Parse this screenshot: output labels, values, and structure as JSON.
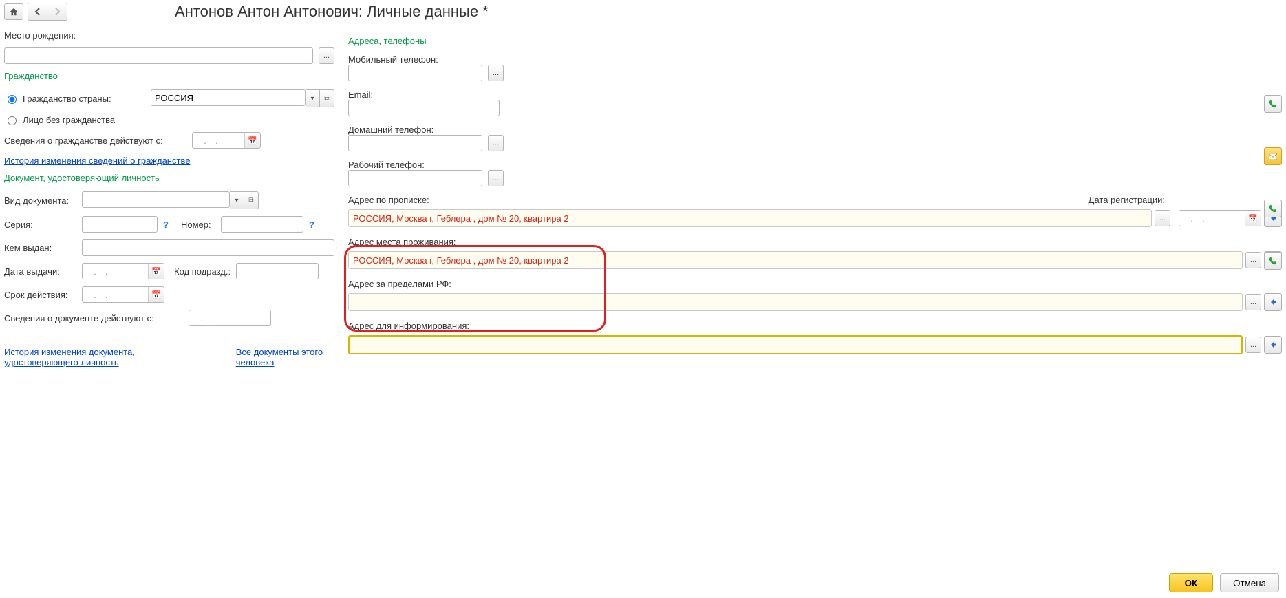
{
  "header": {
    "title": "Антонов Антон Антонович: Личные данные *"
  },
  "birth": {
    "label": "Место рождения:",
    "value": ""
  },
  "citizenship": {
    "section": "Гражданство",
    "radio_country_label": "Гражданство страны:",
    "country_value": "РОССИЯ",
    "radio_stateless_label": "Лицо без гражданства",
    "valid_from_label": "Сведения о гражданстве действуют с:",
    "valid_from_value": "  .  .",
    "history_link": "История изменения сведений о гражданстве"
  },
  "identity": {
    "section": "Документ, удостоверяющий личность",
    "doc_type_label": "Вид документа:",
    "doc_type_value": "",
    "series_label": "Серия:",
    "series_value": "",
    "number_label": "Номер:",
    "number_value": "",
    "issued_by_label": "Кем выдан:",
    "issued_by_value": "",
    "issue_date_label": "Дата выдачи:",
    "issue_date_value": "  .  .",
    "dept_code_label": "Код подразд.:",
    "dept_code_value": "",
    "validity_label": "Срок действия:",
    "validity_value": "  .  .",
    "info_valid_from_label": "Сведения о документе действуют с:",
    "info_valid_from_value": "  .  .",
    "history_link": "История изменения документа, удостоверяющего личность",
    "all_docs_link": "Все документы этого человека"
  },
  "contacts": {
    "section": "Адреса, телефоны",
    "mobile_label": "Мобильный телефон:",
    "mobile_value": "",
    "email_label": "Email:",
    "email_value": "",
    "home_phone_label": "Домашний телефон:",
    "home_phone_value": "",
    "work_phone_label": "Рабочий телефон:",
    "work_phone_value": "",
    "reg_addr_label": "Адрес по прописке:",
    "reg_addr_value": "РОССИЯ, Москва г, Геблера , дом № 20, квартира 2",
    "reg_date_label": "Дата регистрации:",
    "reg_date_value": "  .  .",
    "live_addr_label": "Адрес места проживания:",
    "live_addr_value": "РОССИЯ, Москва г, Геблера , дом № 20, квартира 2",
    "abroad_addr_label": "Адрес за пределами РФ:",
    "abroad_addr_value": "",
    "notify_addr_label": "Адрес для информирования:",
    "notify_addr_value": ""
  },
  "footer": {
    "ok": "ОК",
    "cancel": "Отмена"
  },
  "placeholders": {
    "dots": "...",
    "drop": "▾",
    "open": "⧉",
    "cal": "📅",
    "home": "⌂",
    "back": "←",
    "fwd": "→",
    "q": "?"
  }
}
